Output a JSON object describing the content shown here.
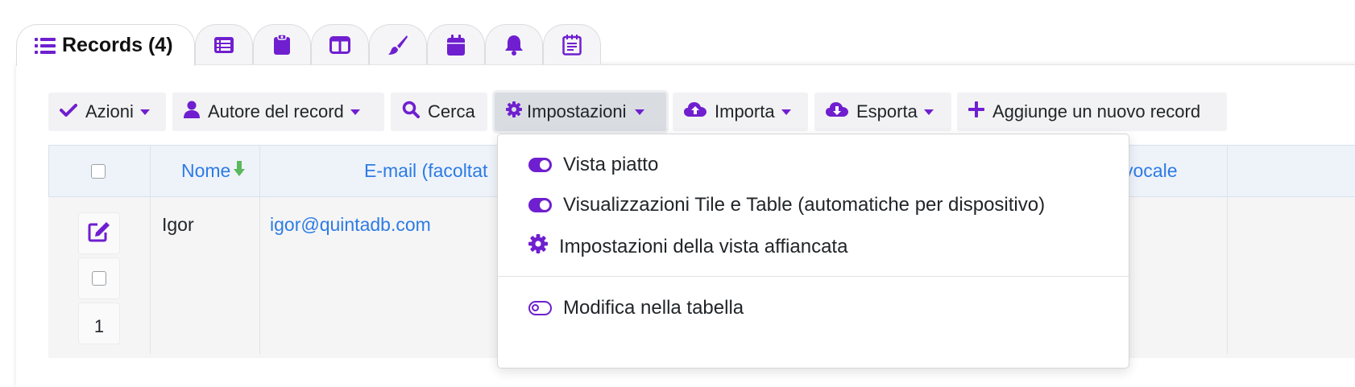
{
  "colors": {
    "accent": "#6f1fcf",
    "link": "#2d7be5",
    "sort_arrow": "#5cb85c"
  },
  "tabs": [
    {
      "label": "Records (4)",
      "icon": "list-icon",
      "active": true
    },
    {
      "icon": "table-list-icon"
    },
    {
      "icon": "clipboard-icon"
    },
    {
      "icon": "columns-icon"
    },
    {
      "icon": "paint-brush-icon"
    },
    {
      "icon": "calendar-icon"
    },
    {
      "icon": "bell-icon"
    },
    {
      "icon": "notepad-icon"
    }
  ],
  "toolbar": {
    "actions": "Azioni",
    "author": "Autore del record",
    "search": "Cerca",
    "settings": "Impostazioni",
    "import": "Importa",
    "export": "Esporta",
    "add": "Aggiunge un nuovo record"
  },
  "table": {
    "headers": {
      "name": "Nome",
      "email": "E-mail (facoltat",
      "voice": "vocale"
    },
    "rows": [
      {
        "name": "Igor",
        "email": "igor@quintadb.com",
        "number": "1"
      }
    ]
  },
  "settings_menu": {
    "items": [
      {
        "label": "Vista piatto",
        "icon": "toggle-on-icon"
      },
      {
        "label": "Visualizzazioni Tile e Table (automatiche per dispositivo)",
        "icon": "toggle-on-icon"
      },
      {
        "label": "Impostazioni della vista affiancata",
        "icon": "gear-icon"
      },
      {
        "label": "Modifica nella tabella",
        "icon": "toggle-off-icon"
      }
    ]
  }
}
